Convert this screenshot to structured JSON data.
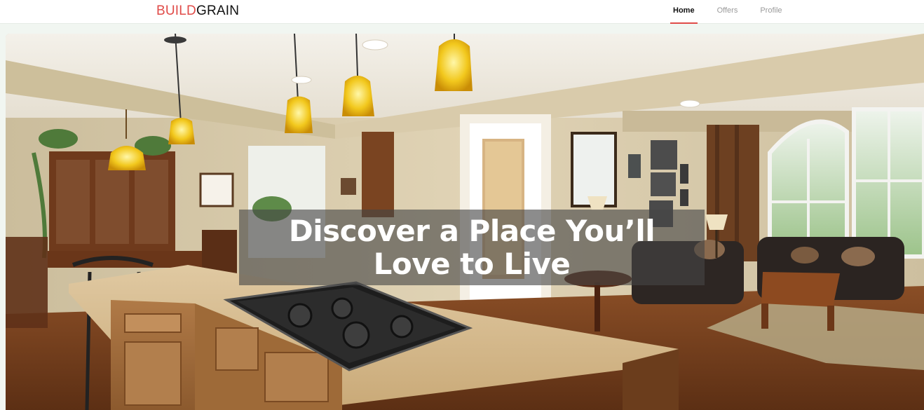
{
  "brand": {
    "part1": "BUILD",
    "part2": "GRAIN",
    "accent_color": "#e04b48"
  },
  "nav": {
    "items": [
      {
        "label": "Home",
        "active": true
      },
      {
        "label": "Offers",
        "active": false
      },
      {
        "label": "Profile",
        "active": false
      }
    ]
  },
  "hero": {
    "headline": "Discover a Place You’ll Love to Live",
    "image": "interior-kitchen-living-room-photo"
  }
}
